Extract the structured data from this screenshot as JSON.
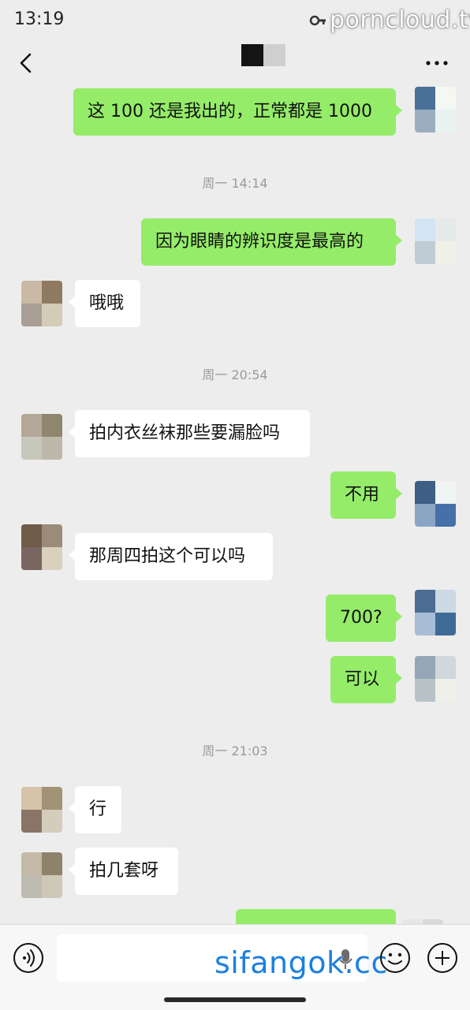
{
  "status_bar": {
    "time": "13:19",
    "watermark": "porncloud.tv"
  },
  "nav": {
    "back_icon": "back-chevron-icon",
    "more_icon": "more-dots-icon"
  },
  "messages": [
    {
      "dir": "out",
      "text": "这 100 还是我出的，正常都是 1000"
    },
    {
      "time": "周一 14:14"
    },
    {
      "dir": "out",
      "text": "因为眼睛的辨识度是最高的"
    },
    {
      "dir": "in",
      "text": "哦哦"
    },
    {
      "time": "周一 20:54"
    },
    {
      "dir": "in",
      "text": "拍内衣丝袜那些要漏脸吗"
    },
    {
      "dir": "out",
      "text": "不用"
    },
    {
      "dir": "in",
      "text": "那周四拍这个可以吗"
    },
    {
      "dir": "out",
      "text": "700?"
    },
    {
      "dir": "out",
      "text": "可以"
    },
    {
      "time": "周一 21:03"
    },
    {
      "dir": "in",
      "text": "行"
    },
    {
      "dir": "in",
      "text": "拍几套呀"
    },
    {
      "dir": "out",
      "text": ""
    }
  ],
  "input_bar": {
    "voice_icon": "voice-icon",
    "emoji_icon": "emoji-icon",
    "plus_icon": "plus-icon",
    "watermark": "sifangok.cc"
  },
  "colors": {
    "outgoing": "#95ec69",
    "incoming": "#ffffff",
    "background": "#ededed"
  }
}
